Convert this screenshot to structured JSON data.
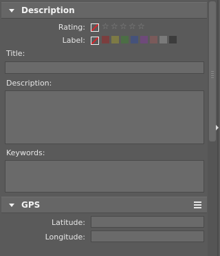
{
  "description_section": {
    "title": "Description",
    "rating_label": "Rating:",
    "label_label": "Label:",
    "title_label": "Title:",
    "description_label": "Description:",
    "keywords_label": "Keywords:",
    "title_value": "",
    "description_value": "",
    "keywords_value": "",
    "rating_value": 0,
    "rating_max": 5,
    "star_glyph": "☆",
    "label_colors": [
      "#7b3e3e",
      "#7d7a45",
      "#4c6e45",
      "#45527a",
      "#6e4a7a",
      "#7a5a5a",
      "#7a7a7a",
      "#3c3c3c"
    ]
  },
  "gps_section": {
    "title": "GPS",
    "latitude_label": "Latitude:",
    "longitude_label": "Longitude:",
    "latitude_value": "",
    "longitude_value": ""
  },
  "colors": {
    "background": "#5a5a5a",
    "header": "#666666",
    "input": "#6a6a6a",
    "no_label_red": "#d8262c"
  }
}
